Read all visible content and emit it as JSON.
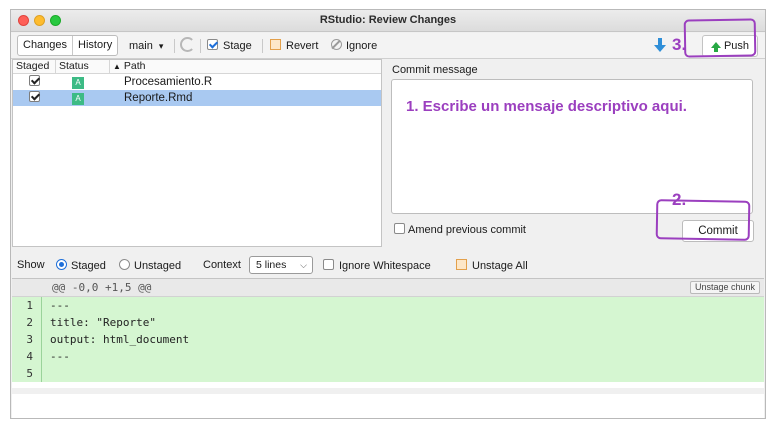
{
  "window": {
    "title": "RStudio: Review Changes"
  },
  "toolbar": {
    "tabs": [
      "Changes",
      "History"
    ],
    "branch": "main",
    "stage_label": "Stage",
    "revert_label": "Revert",
    "ignore_label": "Ignore",
    "push_label": "Push",
    "step3_label": "3."
  },
  "files": {
    "headers": {
      "staged": "Staged",
      "status": "Status",
      "path": "Path"
    },
    "rows": [
      {
        "status": "A",
        "path": "Procesamiento.R",
        "staged": true
      },
      {
        "status": "A",
        "path": "Reporte.Rmd",
        "staged": true
      }
    ]
  },
  "commit": {
    "label": "Commit message",
    "annotation": "1. Escribe un mensaje descriptivo aqui.",
    "amend_label": "Amend previous commit",
    "step2_label": "2.",
    "commit_label": "Commit"
  },
  "options": {
    "show_label": "Show",
    "staged_label": "Staged",
    "unstaged_label": "Unstaged",
    "context_label": "Context",
    "context_value": "5 lines",
    "ignore_ws_label": "Ignore Whitespace",
    "unstage_all_label": "Unstage All"
  },
  "diff": {
    "hunk_header": "@@ -0,0 +1,5 @@",
    "unstage_chunk_label": "Unstage chunk",
    "lines": [
      {
        "n": "1",
        "text": "---"
      },
      {
        "n": "2",
        "text": "title: \"Reporte\""
      },
      {
        "n": "3",
        "text": "output: html_document"
      },
      {
        "n": "4",
        "text": "---"
      },
      {
        "n": "5",
        "text": ""
      }
    ]
  },
  "colors": {
    "annotation": "#9b3fbf",
    "added_line_bg": "#d5f6d1",
    "selected_row": "#a9c9f1"
  }
}
